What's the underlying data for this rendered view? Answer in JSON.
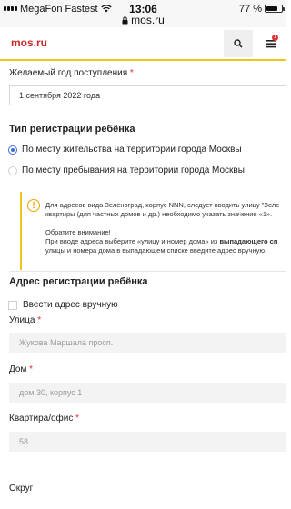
{
  "status_bar": {
    "carrier": "MegaFon Fastest",
    "time": "13:06",
    "battery": "77 %",
    "battery_level": 0.77,
    "url": "mos.ru"
  },
  "header": {
    "logo": "mos.ru",
    "search_icon": "search-icon",
    "menu_icon": "hamburger-menu-icon",
    "menu_badge": "1"
  },
  "form": {
    "year_label": "Желаемый год поступления",
    "year_value": "1 сентября 2022 года",
    "required_mark": "*",
    "registration_type_title": "Тип регистрации ребёнка",
    "radio_options": [
      "По месту жительства на территории города Москвы",
      "По месту пребывания на территории города Москвы"
    ],
    "selected_option_index": 0,
    "info": {
      "icon": "info-icon",
      "line1": "Для адресов вида Зеленоград, корпус NNN, следует вводить улицу \"Зеле",
      "line2": "квартиры (для частных домов и др.) необходимо указать значение «1».",
      "line3": "Обратите внимание!",
      "line4_start": "При вводе адреса выберите «улицу и номер дома» из ",
      "line4_bold": "выпадающего сп",
      "line5": "улицы и номера дома в выпадающем списке введите адрес вручную."
    },
    "address_title": "Адрес регистрации ребёнка",
    "manual_checkbox_label": "Ввести адрес вручную",
    "street_label": "Улица",
    "street_placeholder": "Жукова Маршала просп.",
    "house_label": "Дом",
    "house_placeholder": "дом 30, корпус 1",
    "apartment_label": "Квартира/офис",
    "apartment_value": "58",
    "district_label": "Округ"
  }
}
